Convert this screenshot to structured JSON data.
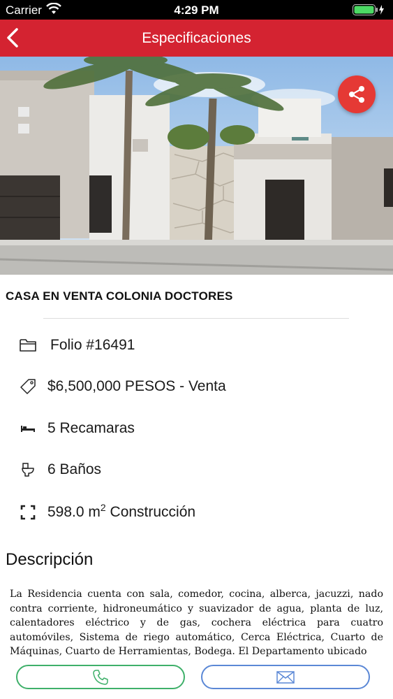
{
  "status_bar": {
    "carrier": "Carrier",
    "time": "4:29 PM"
  },
  "nav": {
    "title": "Especificaciones"
  },
  "property": {
    "title": "CASA EN VENTA COLONIA DOCTORES",
    "folio": "Folio #16491",
    "price": "$6,500,000 PESOS - Venta",
    "bedrooms": "5 Recamaras",
    "bathrooms": "6 Baños",
    "area_value": "598.0 m",
    "area_exp": "2",
    "area_label": " Construcción"
  },
  "description": {
    "heading": "Descripción",
    "text": "La Residencia cuenta con sala, comedor, cocina, alberca, jacuzzi, nado contra corriente, hidroneumático y suavizador de agua, planta de luz, calentadores eléctrico y de gas, cochera eléctrica para cuatro automóviles, Sistema de riego automático, Cerca Eléctrica, Cuarto de Máquinas, Cuarto de Herramientas, Bodega. El Departamento ubicado"
  },
  "icons": {
    "back": "chevron-left-icon",
    "share": "share-icon",
    "folio": "folder-icon",
    "price": "tag-icon",
    "bedrooms": "bed-icon",
    "bathrooms": "toilet-icon",
    "area": "expand-icon",
    "call": "phone-icon",
    "mail": "envelope-icon"
  },
  "colors": {
    "nav": "#d42331",
    "share": "#e53935",
    "call": "#3fb06a",
    "mail": "#5b88d6"
  }
}
